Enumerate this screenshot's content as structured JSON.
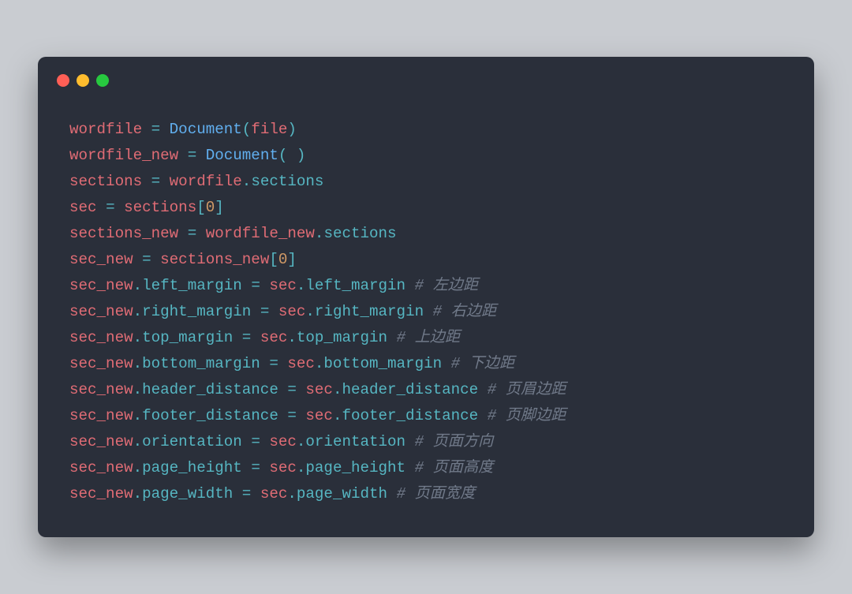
{
  "window": {
    "buttons": [
      "close",
      "minimize",
      "zoom"
    ]
  },
  "code": {
    "lines": [
      [
        {
          "t": "wordfile",
          "c": "tok-var"
        },
        {
          "t": " "
        },
        {
          "t": "=",
          "c": "tok-op"
        },
        {
          "t": " "
        },
        {
          "t": "Document",
          "c": "tok-func"
        },
        {
          "t": "(",
          "c": "tok-op"
        },
        {
          "t": "file",
          "c": "tok-var"
        },
        {
          "t": ")",
          "c": "tok-op"
        }
      ],
      [
        {
          "t": "wordfile_new",
          "c": "tok-var"
        },
        {
          "t": " "
        },
        {
          "t": "=",
          "c": "tok-op"
        },
        {
          "t": " "
        },
        {
          "t": "Document",
          "c": "tok-func"
        },
        {
          "t": "(",
          "c": "tok-op"
        },
        {
          "t": " "
        },
        {
          "t": ")",
          "c": "tok-op"
        }
      ],
      [
        {
          "t": "sections",
          "c": "tok-var"
        },
        {
          "t": " "
        },
        {
          "t": "=",
          "c": "tok-op"
        },
        {
          "t": " "
        },
        {
          "t": "wordfile",
          "c": "tok-var"
        },
        {
          "t": ".",
          "c": "tok-op"
        },
        {
          "t": "sections",
          "c": "tok-attr"
        }
      ],
      [
        {
          "t": "sec",
          "c": "tok-var"
        },
        {
          "t": " "
        },
        {
          "t": "=",
          "c": "tok-op"
        },
        {
          "t": " "
        },
        {
          "t": "sections",
          "c": "tok-var"
        },
        {
          "t": "[",
          "c": "tok-op"
        },
        {
          "t": "0",
          "c": "tok-num"
        },
        {
          "t": "]",
          "c": "tok-op"
        }
      ],
      [
        {
          "t": "sections_new",
          "c": "tok-var"
        },
        {
          "t": " "
        },
        {
          "t": "=",
          "c": "tok-op"
        },
        {
          "t": " "
        },
        {
          "t": "wordfile_new",
          "c": "tok-var"
        },
        {
          "t": ".",
          "c": "tok-op"
        },
        {
          "t": "sections",
          "c": "tok-attr"
        }
      ],
      [
        {
          "t": "sec_new",
          "c": "tok-var"
        },
        {
          "t": " "
        },
        {
          "t": "=",
          "c": "tok-op"
        },
        {
          "t": " "
        },
        {
          "t": "sections_new",
          "c": "tok-var"
        },
        {
          "t": "[",
          "c": "tok-op"
        },
        {
          "t": "0",
          "c": "tok-num"
        },
        {
          "t": "]",
          "c": "tok-op"
        }
      ],
      [
        {
          "t": "sec_new",
          "c": "tok-var"
        },
        {
          "t": ".",
          "c": "tok-op"
        },
        {
          "t": "left_margin",
          "c": "tok-attr"
        },
        {
          "t": " "
        },
        {
          "t": "=",
          "c": "tok-op"
        },
        {
          "t": " "
        },
        {
          "t": "sec",
          "c": "tok-var"
        },
        {
          "t": ".",
          "c": "tok-op"
        },
        {
          "t": "left_margin",
          "c": "tok-attr"
        },
        {
          "t": " "
        },
        {
          "t": "# 左边距",
          "c": "tok-cmt"
        }
      ],
      [
        {
          "t": "sec_new",
          "c": "tok-var"
        },
        {
          "t": ".",
          "c": "tok-op"
        },
        {
          "t": "right_margin",
          "c": "tok-attr"
        },
        {
          "t": " "
        },
        {
          "t": "=",
          "c": "tok-op"
        },
        {
          "t": " "
        },
        {
          "t": "sec",
          "c": "tok-var"
        },
        {
          "t": ".",
          "c": "tok-op"
        },
        {
          "t": "right_margin",
          "c": "tok-attr"
        },
        {
          "t": " "
        },
        {
          "t": "# 右边距",
          "c": "tok-cmt"
        }
      ],
      [
        {
          "t": "sec_new",
          "c": "tok-var"
        },
        {
          "t": ".",
          "c": "tok-op"
        },
        {
          "t": "top_margin",
          "c": "tok-attr"
        },
        {
          "t": " "
        },
        {
          "t": "=",
          "c": "tok-op"
        },
        {
          "t": " "
        },
        {
          "t": "sec",
          "c": "tok-var"
        },
        {
          "t": ".",
          "c": "tok-op"
        },
        {
          "t": "top_margin",
          "c": "tok-attr"
        },
        {
          "t": " "
        },
        {
          "t": "# 上边距",
          "c": "tok-cmt"
        }
      ],
      [
        {
          "t": "sec_new",
          "c": "tok-var"
        },
        {
          "t": ".",
          "c": "tok-op"
        },
        {
          "t": "bottom_margin",
          "c": "tok-attr"
        },
        {
          "t": " "
        },
        {
          "t": "=",
          "c": "tok-op"
        },
        {
          "t": " "
        },
        {
          "t": "sec",
          "c": "tok-var"
        },
        {
          "t": ".",
          "c": "tok-op"
        },
        {
          "t": "bottom_margin",
          "c": "tok-attr"
        },
        {
          "t": " "
        },
        {
          "t": "# 下边距",
          "c": "tok-cmt"
        }
      ],
      [
        {
          "t": "sec_new",
          "c": "tok-var"
        },
        {
          "t": ".",
          "c": "tok-op"
        },
        {
          "t": "header_distance",
          "c": "tok-attr"
        },
        {
          "t": " "
        },
        {
          "t": "=",
          "c": "tok-op"
        },
        {
          "t": " "
        },
        {
          "t": "sec",
          "c": "tok-var"
        },
        {
          "t": ".",
          "c": "tok-op"
        },
        {
          "t": "header_distance",
          "c": "tok-attr"
        },
        {
          "t": " "
        },
        {
          "t": "# 页眉边距",
          "c": "tok-cmt"
        }
      ],
      [
        {
          "t": "sec_new",
          "c": "tok-var"
        },
        {
          "t": ".",
          "c": "tok-op"
        },
        {
          "t": "footer_distance",
          "c": "tok-attr"
        },
        {
          "t": " "
        },
        {
          "t": "=",
          "c": "tok-op"
        },
        {
          "t": " "
        },
        {
          "t": "sec",
          "c": "tok-var"
        },
        {
          "t": ".",
          "c": "tok-op"
        },
        {
          "t": "footer_distance",
          "c": "tok-attr"
        },
        {
          "t": " "
        },
        {
          "t": "# 页脚边距",
          "c": "tok-cmt"
        }
      ],
      [
        {
          "t": "sec_new",
          "c": "tok-var"
        },
        {
          "t": ".",
          "c": "tok-op"
        },
        {
          "t": "orientation",
          "c": "tok-attr"
        },
        {
          "t": " "
        },
        {
          "t": "=",
          "c": "tok-op"
        },
        {
          "t": " "
        },
        {
          "t": "sec",
          "c": "tok-var"
        },
        {
          "t": ".",
          "c": "tok-op"
        },
        {
          "t": "orientation",
          "c": "tok-attr"
        },
        {
          "t": " "
        },
        {
          "t": "# 页面方向",
          "c": "tok-cmt"
        }
      ],
      [
        {
          "t": "sec_new",
          "c": "tok-var"
        },
        {
          "t": ".",
          "c": "tok-op"
        },
        {
          "t": "page_height",
          "c": "tok-attr"
        },
        {
          "t": " "
        },
        {
          "t": "=",
          "c": "tok-op"
        },
        {
          "t": " "
        },
        {
          "t": "sec",
          "c": "tok-var"
        },
        {
          "t": ".",
          "c": "tok-op"
        },
        {
          "t": "page_height",
          "c": "tok-attr"
        },
        {
          "t": " "
        },
        {
          "t": "# 页面高度",
          "c": "tok-cmt"
        }
      ],
      [
        {
          "t": "sec_new",
          "c": "tok-var"
        },
        {
          "t": ".",
          "c": "tok-op"
        },
        {
          "t": "page_width",
          "c": "tok-attr"
        },
        {
          "t": " "
        },
        {
          "t": "=",
          "c": "tok-op"
        },
        {
          "t": " "
        },
        {
          "t": "sec",
          "c": "tok-var"
        },
        {
          "t": ".",
          "c": "tok-op"
        },
        {
          "t": "page_width",
          "c": "tok-attr"
        },
        {
          "t": " "
        },
        {
          "t": "# 页面宽度",
          "c": "tok-cmt"
        }
      ]
    ]
  }
}
